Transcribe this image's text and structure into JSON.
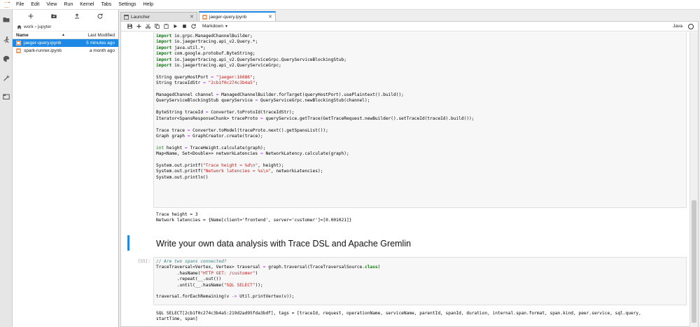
{
  "menu": [
    "File",
    "Edit",
    "View",
    "Run",
    "Kernel",
    "Tabs",
    "Settings",
    "Help"
  ],
  "filebrowser": {
    "breadcrumb": [
      "work",
      "jupyter"
    ],
    "header": {
      "name": "Name",
      "modified": "Last Modified"
    },
    "files": [
      {
        "name": "jaeger-query.ipynb",
        "modified": "5 minutes ago",
        "selected": true
      },
      {
        "name": "spark-runner.ipynb",
        "modified": "a month ago",
        "selected": false
      }
    ]
  },
  "tabs": [
    {
      "label": "Launcher",
      "active": false
    },
    {
      "label": "jaeger-query.ipynb",
      "active": true
    }
  ],
  "toolbar": {
    "cell_type": "Markdown",
    "kernel": "Java"
  },
  "cells": {
    "cell1_output": [
      "Trace height = 3",
      "Network latencies = {Name[client='frontend', server='customer']=[0.001021]}"
    ],
    "markdown_heading": "Write your own data analysis with Trace DSL and Apache Gremlin",
    "cell2_prompt": "[55]:",
    "cell2_output": [
      "SQL SELECT[2cb1f0c274c3b4a5:219d2ad95fda3bdf], tags = [traceId, request, operationName, serviceName, parentId, spanId, duration, internal.span.format, span.kind, peer.service, sql.query,",
      "startTime, span]"
    ]
  },
  "colors": {
    "accent": "#1e88e5",
    "keyword": "#008000",
    "string": "#ba2121"
  },
  "icons": [
    "jupyter-logo-icon",
    "folder-icon",
    "running-icon",
    "palette-icon",
    "wrench-icon",
    "tabs-icon",
    "new-launcher-icon",
    "new-folder-icon",
    "upload-icon",
    "refresh-icon",
    "home-icon",
    "notebook-icon",
    "save-icon",
    "add-cell-icon",
    "cut-icon",
    "copy-icon",
    "paste-icon",
    "run-icon",
    "stop-icon",
    "restart-icon",
    "close-icon",
    "kernel-status-icon"
  ]
}
